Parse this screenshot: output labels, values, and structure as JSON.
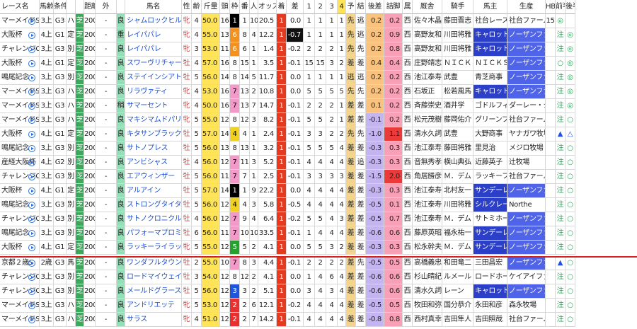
{
  "columns": [
    "レース名",
    "馬齢",
    "条件",
    "",
    "",
    "距離",
    "外",
    "",
    "馬名",
    "性",
    "齢",
    "斤量",
    "頭",
    "枠",
    "番",
    "人",
    "オッズ",
    "着",
    "差",
    "1",
    "2",
    "3",
    "4",
    "予",
    "結",
    "後差",
    "詰脚",
    "属",
    "厩舎",
    "騎手",
    "馬主",
    "生産",
    "HB",
    "前半",
    "後半"
  ],
  "widths": [
    56,
    20,
    18,
    13,
    12,
    16,
    30,
    12,
    80,
    14,
    14,
    26,
    14,
    14,
    14,
    12,
    26,
    14,
    24,
    16,
    16,
    16,
    12,
    14,
    14,
    26,
    26,
    14,
    42,
    44,
    48,
    54,
    14,
    14,
    14
  ],
  "colors": {
    "frame": [
      "#ffffff",
      "#000000",
      "#e83030",
      "#1f55d8",
      "#f0d020",
      "#27a030",
      "#f39020",
      "#f29ac8"
    ],
    "frame_text": [
      "#000000",
      "#ffffff",
      "#ffffff",
      "#ffffff",
      "#000000",
      "#ffffff",
      "#ffffff",
      "#000000"
    ],
    "odds_bg": "#ffe45a",
    "cond_bg": "#3ca85c",
    "baba_bg": "#93e0b8",
    "chaku_bg": "#e63a20",
    "pred_bg": "#f3d48a",
    "diff_bg": "#f9c27e",
    "zero_bg": "#7fe060",
    "neg_bg": "#c4b5f0",
    "pos_bg": "#f7a0b6",
    "red_bg": "#ea3a3a",
    "owner_blue": "#2b3fc8",
    "owner_text": "#ffffff",
    "breeder_blue": "#4f64e8"
  },
  "rows": [
    [
      "マーメイドS",
      "3上",
      "G3",
      "ハ",
      "芝",
      "2000",
      "-",
      "良",
      "シャムロックヒル",
      "牝",
      "4",
      "50.0",
      "16",
      "1",
      "1",
      "10",
      "20.5",
      "1",
      "0.0",
      "1",
      "1",
      "1",
      "1",
      "先",
      "逃",
      "0.2",
      "0.2",
      "西",
      "佐々木晶",
      "藤田晋志",
      "社台レースホ",
      "社台ファーム",
      "15",
      "◎",
      ""
    ],
    [
      "大阪杯",
      "4上",
      "G1",
      "定",
      "芝",
      "2000",
      "-",
      "重",
      "レイパパレ",
      "牝",
      "4",
      "55.0",
      "13",
      "6",
      "8",
      "4",
      "12.2",
      "1",
      "-0.7",
      "1",
      "1",
      "1",
      "1",
      "先",
      "逃",
      "0.2",
      "0.9",
      "西",
      "高野友和",
      "川田将雅",
      "キャロット",
      "ノーザンファ",
      "",
      "注",
      "◎"
    ],
    [
      "チャレンジC",
      "3上",
      "G3",
      "別",
      "芝",
      "2000",
      "-",
      "良",
      "レイパパレ",
      "牝",
      "3",
      "53.0",
      "11",
      "6",
      "6",
      "1",
      "1.4",
      "1",
      "-0.2",
      "2",
      "2",
      "2",
      "1",
      "先",
      "先",
      "0.2",
      "0.8",
      "西",
      "高野友和",
      "川田将雅",
      "キャロット",
      "ノーザンファ",
      "",
      "注",
      "◎"
    ],
    [
      "大阪杯",
      "4上",
      "G1",
      "定",
      "芝",
      "2000",
      "-",
      "良",
      "スワーヴリチャード",
      "牡",
      "4",
      "57.0",
      "16",
      "8",
      "15",
      "1",
      "3.5",
      "1",
      "-0.1",
      "15",
      "15",
      "3",
      "2",
      "差",
      "差",
      "0.4",
      "0.4",
      "西",
      "庄野靖志",
      "ＮＩＣＫＳ",
      "ＮＩＣＫＳ",
      "ノーザンファ",
      "",
      "○",
      "◎"
    ],
    [
      "鳴尾記念",
      "3上",
      "G3",
      "別",
      "芝",
      "2000",
      "-",
      "良",
      "ステイインシアトル",
      "牡",
      "5",
      "56.0",
      "14",
      "8",
      "14",
      "5",
      "11.7",
      "1",
      "0.0",
      "1",
      "1",
      "1",
      "1",
      "逃",
      "逃",
      "0.2",
      "0.2",
      "西",
      "池江泰寿",
      "武豊",
      "青芝商事",
      "ノーザンファ",
      "",
      "注",
      "◎"
    ],
    [
      "マーメイドS",
      "3上",
      "G3",
      "ハ",
      "芝",
      "2000",
      "-",
      "良",
      "リラヴァティ",
      "牝",
      "4",
      "53.0",
      "16",
      "7",
      "13",
      "2",
      "10.8",
      "1",
      "0.0",
      "5",
      "5",
      "5",
      "5",
      "先",
      "先",
      "0.2",
      "0.2",
      "西",
      "石坂正",
      "松若風馬",
      "キャロット",
      "ノーザンファ",
      "",
      "注",
      "◎"
    ],
    [
      "マーメイドS",
      "3上",
      "G3",
      "ハ",
      "芝",
      "2000",
      "-",
      "稍",
      "サマーセント",
      "牝",
      "4",
      "50.0",
      "16",
      "7",
      "13",
      "7",
      "14.7",
      "1",
      "-0.1",
      "2",
      "2",
      "2",
      "1",
      "差",
      "差",
      "0.1",
      "0.2",
      "西",
      "斉藤崇史",
      "酒井学",
      "ゴドルフィン",
      "ダーレー・ジ",
      "",
      "注",
      "◎"
    ],
    [
      "マーメイドS",
      "3上",
      "G3",
      "ハ",
      "芝",
      "2000",
      "-",
      "良",
      "マキシマムドパリ",
      "牝",
      "5",
      "55.0",
      "12",
      "8",
      "12",
      "3",
      "8.2",
      "1",
      "-0.1",
      "5",
      "5",
      "2",
      "1",
      "差",
      "差",
      "-0.1",
      "0.2",
      "西",
      "松元茂樹",
      "藤岡佑介",
      "グリーンファ",
      "社台ファーム",
      "",
      "注",
      "○"
    ],
    [
      "大阪杯",
      "4上",
      "G1",
      "定",
      "芝",
      "2000",
      "-",
      "良",
      "キタサンブラック",
      "牡",
      "5",
      "57.0",
      "14",
      "4",
      "4",
      "1",
      "2.4",
      "1",
      "-0.1",
      "3",
      "3",
      "2",
      "2",
      "先",
      "先",
      "-1.0",
      "1.1",
      "西",
      "清水久詞",
      "武豊",
      "大野商事",
      "ヤナガワ牧場",
      "",
      "▲",
      "△"
    ],
    [
      "鳴尾記念",
      "3上",
      "G3",
      "別",
      "芝",
      "2000",
      "-",
      "良",
      "サトノプレス",
      "牡",
      "5",
      "56.0",
      "13",
      "8",
      "13",
      "1",
      "3.2",
      "1",
      "-0.1",
      "5",
      "5",
      "5",
      "4",
      "差",
      "差",
      "-0.3",
      "0.3",
      "西",
      "池江泰寿",
      "藤田将雅",
      "里見治",
      "メジロ牧場",
      "",
      "注",
      "○"
    ],
    [
      "産経大阪杯",
      "4上",
      "G2",
      "別",
      "芝",
      "2000",
      "-",
      "良",
      "アンビシャス",
      "牡",
      "4",
      "56.0",
      "12",
      "7",
      "11",
      "3",
      "5.2",
      "1",
      "-0.1",
      "4",
      "4",
      "4",
      "4",
      "差",
      "追",
      "-0.3",
      "0.3",
      "西",
      "音無秀孝",
      "横山典弘",
      "近藤英子",
      "辻牧場",
      "",
      "注",
      "○"
    ],
    [
      "チャレンジC",
      "3上",
      "G3",
      "別",
      "芝",
      "2000",
      "-",
      "良",
      "エアウィンザー",
      "牡",
      "5",
      "56.0",
      "11",
      "7",
      "7",
      "1",
      "2.5",
      "1",
      "-0.1",
      "3",
      "3",
      "3",
      "3",
      "差",
      "差",
      "-1.5",
      "2.0",
      "西",
      "角居勝彦",
      "Ｍ．デム",
      "ラッキーフィ",
      "社台ファーム",
      "",
      "注",
      "○"
    ],
    [
      "大阪杯",
      "4上",
      "G1",
      "定",
      "芝",
      "2000",
      "-",
      "良",
      "アルアイン",
      "牡",
      "5",
      "57.0",
      "14",
      "1",
      "1",
      "9",
      "22.2",
      "1",
      "0.0",
      "4",
      "4",
      "4",
      "4",
      "差",
      "差",
      "-0.3",
      "0.3",
      "西",
      "池江泰寿",
      "北村友一",
      "サンデーレ",
      "ノーザンファ",
      "",
      "注",
      "○"
    ],
    [
      "鳴尾記念",
      "3上",
      "G3",
      "別",
      "芝",
      "2000",
      "-",
      "良",
      "ストロングタイタン",
      "牡",
      "5",
      "56.0",
      "12",
      "4",
      "4",
      "3",
      "5.8",
      "1",
      "-0.5",
      "4",
      "4",
      "4",
      "4",
      "差",
      "差",
      "-0.5",
      "0.1",
      "西",
      "池江泰寿",
      "川田将雅",
      "シルクレーシ",
      "Northe",
      "",
      "注",
      "○"
    ],
    [
      "チャレンジC",
      "3上",
      "G3",
      "別",
      "芝",
      "2000",
      "-",
      "良",
      "サトノクロニクル",
      "牡",
      "4",
      "56.0",
      "12",
      "7",
      "9",
      "4",
      "6.4",
      "1",
      "-0.2",
      "5",
      "5",
      "4",
      "3",
      "差",
      "差",
      "-0.5",
      "0.7",
      "西",
      "池江泰寿",
      "Ｍ．デム",
      "サトミホース",
      "ノーザンファ",
      "",
      "注",
      "○"
    ],
    [
      "鳴尾記念",
      "3上",
      "G3",
      "別",
      "芝",
      "2000",
      "-",
      "良",
      "パフォーマプロミス",
      "牡",
      "6",
      "56.0",
      "11",
      "7",
      "10",
      "10",
      "33.5",
      "1",
      "-0.1",
      "1",
      "4",
      "4",
      "4",
      "差",
      "差",
      "-0.6",
      "0.6",
      "西",
      "藤原英昭",
      "福永祐一",
      "サンデーレ",
      "ノーザンファ",
      "",
      "注",
      "○"
    ],
    [
      "大阪杯",
      "4上",
      "G1",
      "定",
      "芝",
      "2000",
      "-",
      "良",
      "ラッキーライラック",
      "牝",
      "5",
      "55.0",
      "12",
      "5",
      "5",
      "2",
      "4.1",
      "1",
      "0.0",
      "5",
      "5",
      "3",
      "2",
      "差",
      "差",
      "-0.3",
      "0.3",
      "西",
      "松永幹夫",
      "Ｍ．デム",
      "サンデーレ",
      "ノーザンファ",
      "",
      "注",
      "○"
    ],
    [
      "京都２歳S",
      "2歳",
      "G3",
      "馬",
      "芝",
      "2000",
      "-",
      "良",
      "ワンダフルタウン",
      "牡",
      "2",
      "55.0",
      "10",
      "7",
      "8",
      "3",
      "4.4",
      "1",
      "-0.1",
      "2",
      "2",
      "2",
      "2",
      "差",
      "先",
      "-0.5",
      "0.5",
      "西",
      "高橋義忠",
      "和田竜二",
      "三田昌宏",
      "ノーザンファ",
      "",
      "▲",
      "○"
    ],
    [
      "チャレンジC",
      "3上",
      "G3",
      "別",
      "芝",
      "2000",
      "-",
      "良",
      "ロードマイウェイ",
      "牡",
      "3",
      "54.0",
      "12",
      "8",
      "12",
      "2",
      "4.1",
      "1",
      "0.0",
      "1",
      "4",
      "6",
      "4",
      "差",
      "差",
      "-0.6",
      "0.6",
      "西",
      "杉山晴紀",
      "ルメール",
      "ロードホース",
      "ケイアイファ",
      "",
      "注",
      "○"
    ],
    [
      "チャレンジC",
      "3上",
      "G3",
      "別",
      "芝",
      "2000",
      "-",
      "良",
      "メールドグラース",
      "牡",
      "5",
      "56.0",
      "12",
      "3",
      "3",
      "2",
      "5.1",
      "1",
      "0.0",
      "3",
      "4",
      "3",
      "4",
      "差",
      "差",
      "-0.6",
      "0.6",
      "西",
      "清水久詞",
      "レーン",
      "キャロット",
      "ノーザンファ",
      "",
      "注",
      "○"
    ],
    [
      "マーメイドS",
      "3上",
      "G3",
      "ハ",
      "芝",
      "2000",
      "-",
      "良",
      "アンドリエッテ",
      "牝",
      "5",
      "53.0",
      "12",
      "2",
      "2",
      "6",
      "12.1",
      "1",
      "-0.2",
      "4",
      "4",
      "4",
      "4",
      "差",
      "差",
      "-0.5",
      "0.5",
      "西",
      "牧田和弥",
      "国分恭介",
      "永田和彦",
      "森永牧場",
      "",
      "注",
      "○"
    ],
    [
      "マーメイドS",
      "3上",
      "G3",
      "ハ",
      "芝",
      "2000",
      "-",
      "良",
      "サラス",
      "牝",
      "4",
      "51.0",
      "12",
      "2",
      "2",
      "7",
      "14.2",
      "1",
      "-0.1",
      "4",
      "4",
      "4",
      "4",
      "差",
      "差",
      "-0.8",
      "0.8",
      "西",
      "西村真幸",
      "吉田隼人",
      "吉田照哉",
      "社台ファーム",
      "",
      "注",
      "○"
    ]
  ]
}
